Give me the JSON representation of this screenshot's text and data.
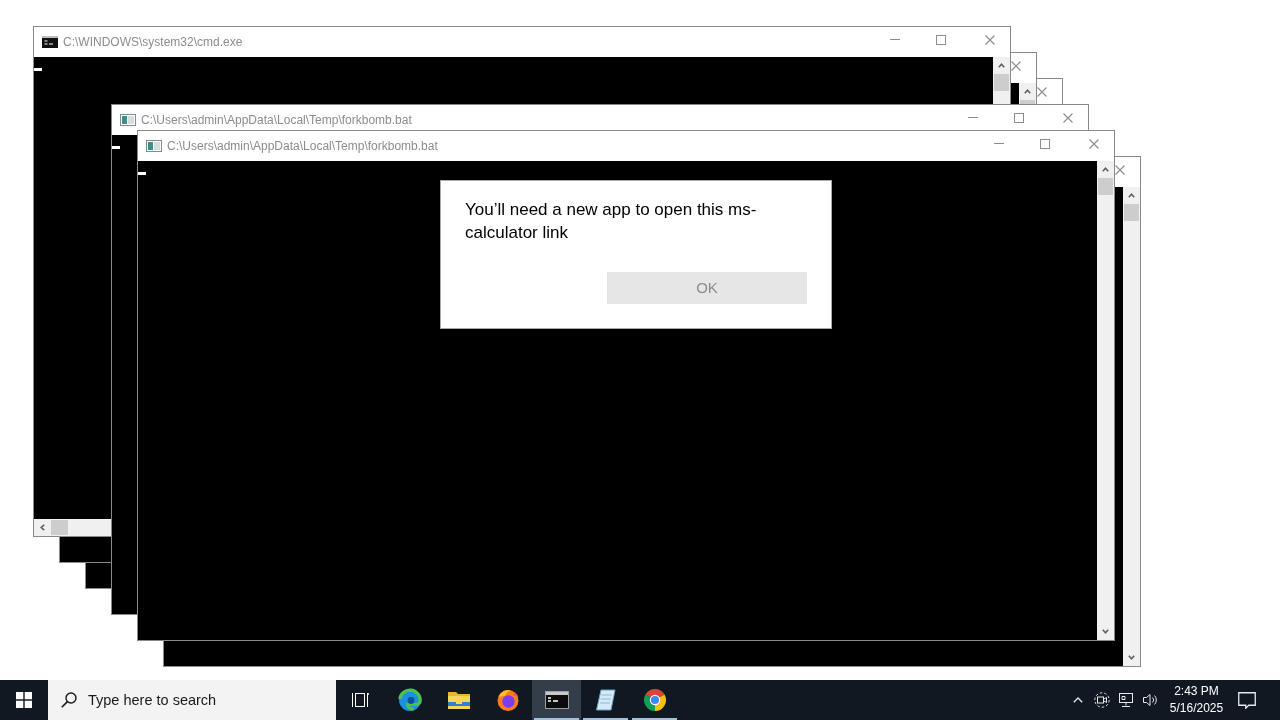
{
  "windows": [
    {
      "kind": "cmd",
      "title": "C:\\WINDOWS\\system32\\cmd.exe",
      "active": false
    },
    {
      "kind": "batch",
      "active": false
    },
    {
      "kind": "batch",
      "active": false
    },
    {
      "kind": "batch",
      "title": "C:\\Users\\admin\\AppData\\Local\\Temp\\forkbomb.bat",
      "active": false
    },
    {
      "kind": "batch",
      "title": "C:\\Users\\admin\\AppData\\Local\\Temp\\forkbomb.bat",
      "active": false
    },
    {
      "kind": "batch",
      "active": false
    }
  ],
  "dialog": {
    "message": "You’ll need a new app to open this ms-calculator link",
    "buttons": [
      "OK"
    ]
  },
  "taskbar": {
    "search": {
      "placeholder": "Type here to search"
    },
    "apps": [
      {
        "running": false,
        "selected": false
      },
      {
        "running": false,
        "selected": false
      },
      {
        "running": false,
        "selected": false
      },
      {
        "running": true,
        "selected": true
      },
      {
        "running": true,
        "selected": false
      },
      {
        "running": true,
        "selected": false
      }
    ],
    "clock": {
      "time": "2:43 PM",
      "date": "5/16/2025"
    }
  }
}
